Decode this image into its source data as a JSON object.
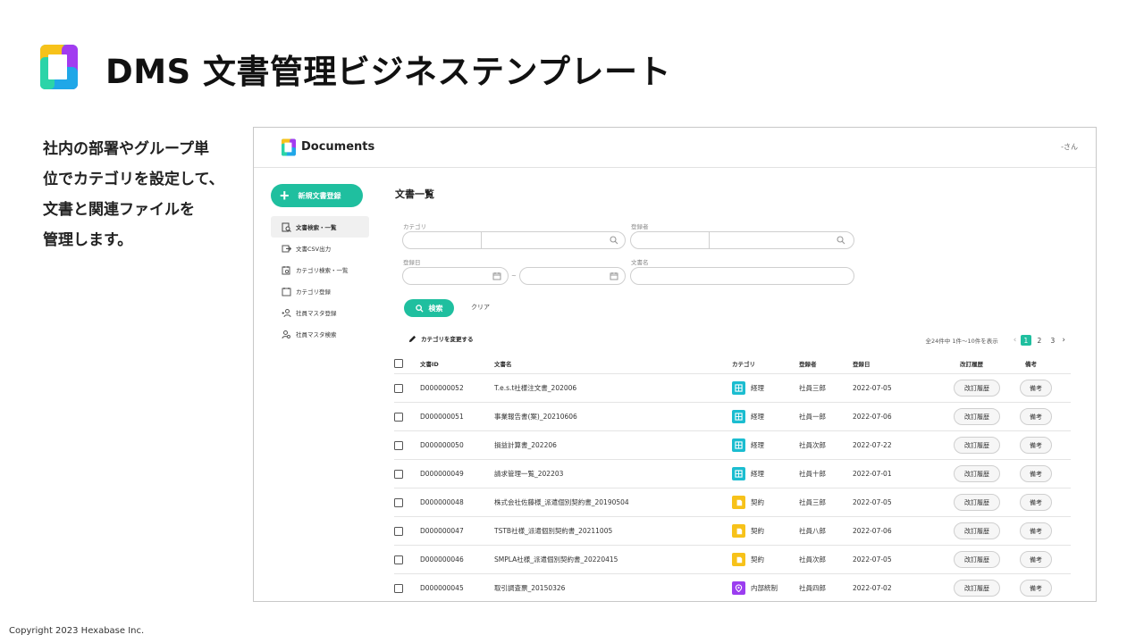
{
  "slide": {
    "title": "DMS 文書管理ビジネステンプレート",
    "description_lines": [
      "社内の部署やグループ単",
      "位でカテゴリを設定して、",
      "文書と関連ファイルを",
      "管理します。"
    ],
    "copyright": "Copyright 2023 Hexabase Inc."
  },
  "app": {
    "name": "Documents",
    "user": "-さん",
    "new_button_label": "新規文書登録",
    "nav": [
      {
        "label": "文書検索・一覧",
        "icon": "document-search-icon",
        "active": true
      },
      {
        "label": "文書CSV出力",
        "icon": "export-icon",
        "active": false
      },
      {
        "label": "カテゴリ検索・一覧",
        "icon": "category-search-icon",
        "active": false
      },
      {
        "label": "カテゴリ登録",
        "icon": "calendar-add-icon",
        "active": false
      },
      {
        "label": "社員マスタ登録",
        "icon": "user-add-icon",
        "active": false
      },
      {
        "label": "社員マスタ検索",
        "icon": "user-search-icon",
        "active": false
      }
    ],
    "page_title": "文書一覧",
    "filters": {
      "category_label": "カテゴリ",
      "registrant_label": "登録者",
      "date_label": "登録日",
      "date_separator": "~",
      "docname_label": "文書名"
    },
    "search_label": "検索",
    "clear_label": "クリア",
    "change_category_label": "カテゴリを変更する",
    "pagination": {
      "summary": "全24件中 1件〜10件を表示",
      "pages": [
        "1",
        "2",
        "3"
      ],
      "current": "1",
      "prev": "‹",
      "next": "›"
    },
    "columns": {
      "id": "文書ID",
      "name": "文書名",
      "category": "カテゴリ",
      "registrant": "登録者",
      "date": "登録日",
      "history": "改訂履歴",
      "note": "備考"
    },
    "rows": [
      {
        "id": "D000000052",
        "name": "T.e.s.t社様注文書_202006",
        "category": "経理",
        "cat_icon": "ledger-icon",
        "cat_color": "#1bbdd0",
        "registrant": "社員三郎",
        "date": "2022-07-05",
        "history": "改訂履歴",
        "note": "備考"
      },
      {
        "id": "D000000051",
        "name": "事業報告書(案)_20210606",
        "category": "経理",
        "cat_icon": "ledger-icon",
        "cat_color": "#1bbdd0",
        "registrant": "社員一郎",
        "date": "2022-07-06",
        "history": "改訂履歴",
        "note": "備考"
      },
      {
        "id": "D000000050",
        "name": "損益計算書_202206",
        "category": "経理",
        "cat_icon": "ledger-icon",
        "cat_color": "#1bbdd0",
        "registrant": "社員次郎",
        "date": "2022-07-22",
        "history": "改訂履歴",
        "note": "備考"
      },
      {
        "id": "D000000049",
        "name": "請求管理一覧_202203",
        "category": "経理",
        "cat_icon": "ledger-icon",
        "cat_color": "#1bbdd0",
        "registrant": "社員十郎",
        "date": "2022-07-01",
        "history": "改訂履歴",
        "note": "備考"
      },
      {
        "id": "D000000048",
        "name": "株式会社佐藤様_派遣個別契約書_20190504",
        "category": "契約",
        "cat_icon": "contract-icon",
        "cat_color": "#f7c21a",
        "registrant": "社員三郎",
        "date": "2022-07-05",
        "history": "改訂履歴",
        "note": "備考"
      },
      {
        "id": "D000000047",
        "name": "TSTB社様_派遣個別契約書_20211005",
        "category": "契約",
        "cat_icon": "contract-icon",
        "cat_color": "#f7c21a",
        "registrant": "社員八郎",
        "date": "2022-07-06",
        "history": "改訂履歴",
        "note": "備考"
      },
      {
        "id": "D000000046",
        "name": "SMPLA社様_派遣個別契約書_20220415",
        "category": "契約",
        "cat_icon": "contract-icon",
        "cat_color": "#f7c21a",
        "registrant": "社員次郎",
        "date": "2022-07-05",
        "history": "改訂履歴",
        "note": "備考"
      },
      {
        "id": "D000000045",
        "name": "取引調査票_20150326",
        "category": "内部統制",
        "cat_icon": "pin-icon",
        "cat_color": "#9b3df0",
        "registrant": "社員四郎",
        "date": "2022-07-02",
        "history": "改訂履歴",
        "note": "備考"
      }
    ]
  }
}
